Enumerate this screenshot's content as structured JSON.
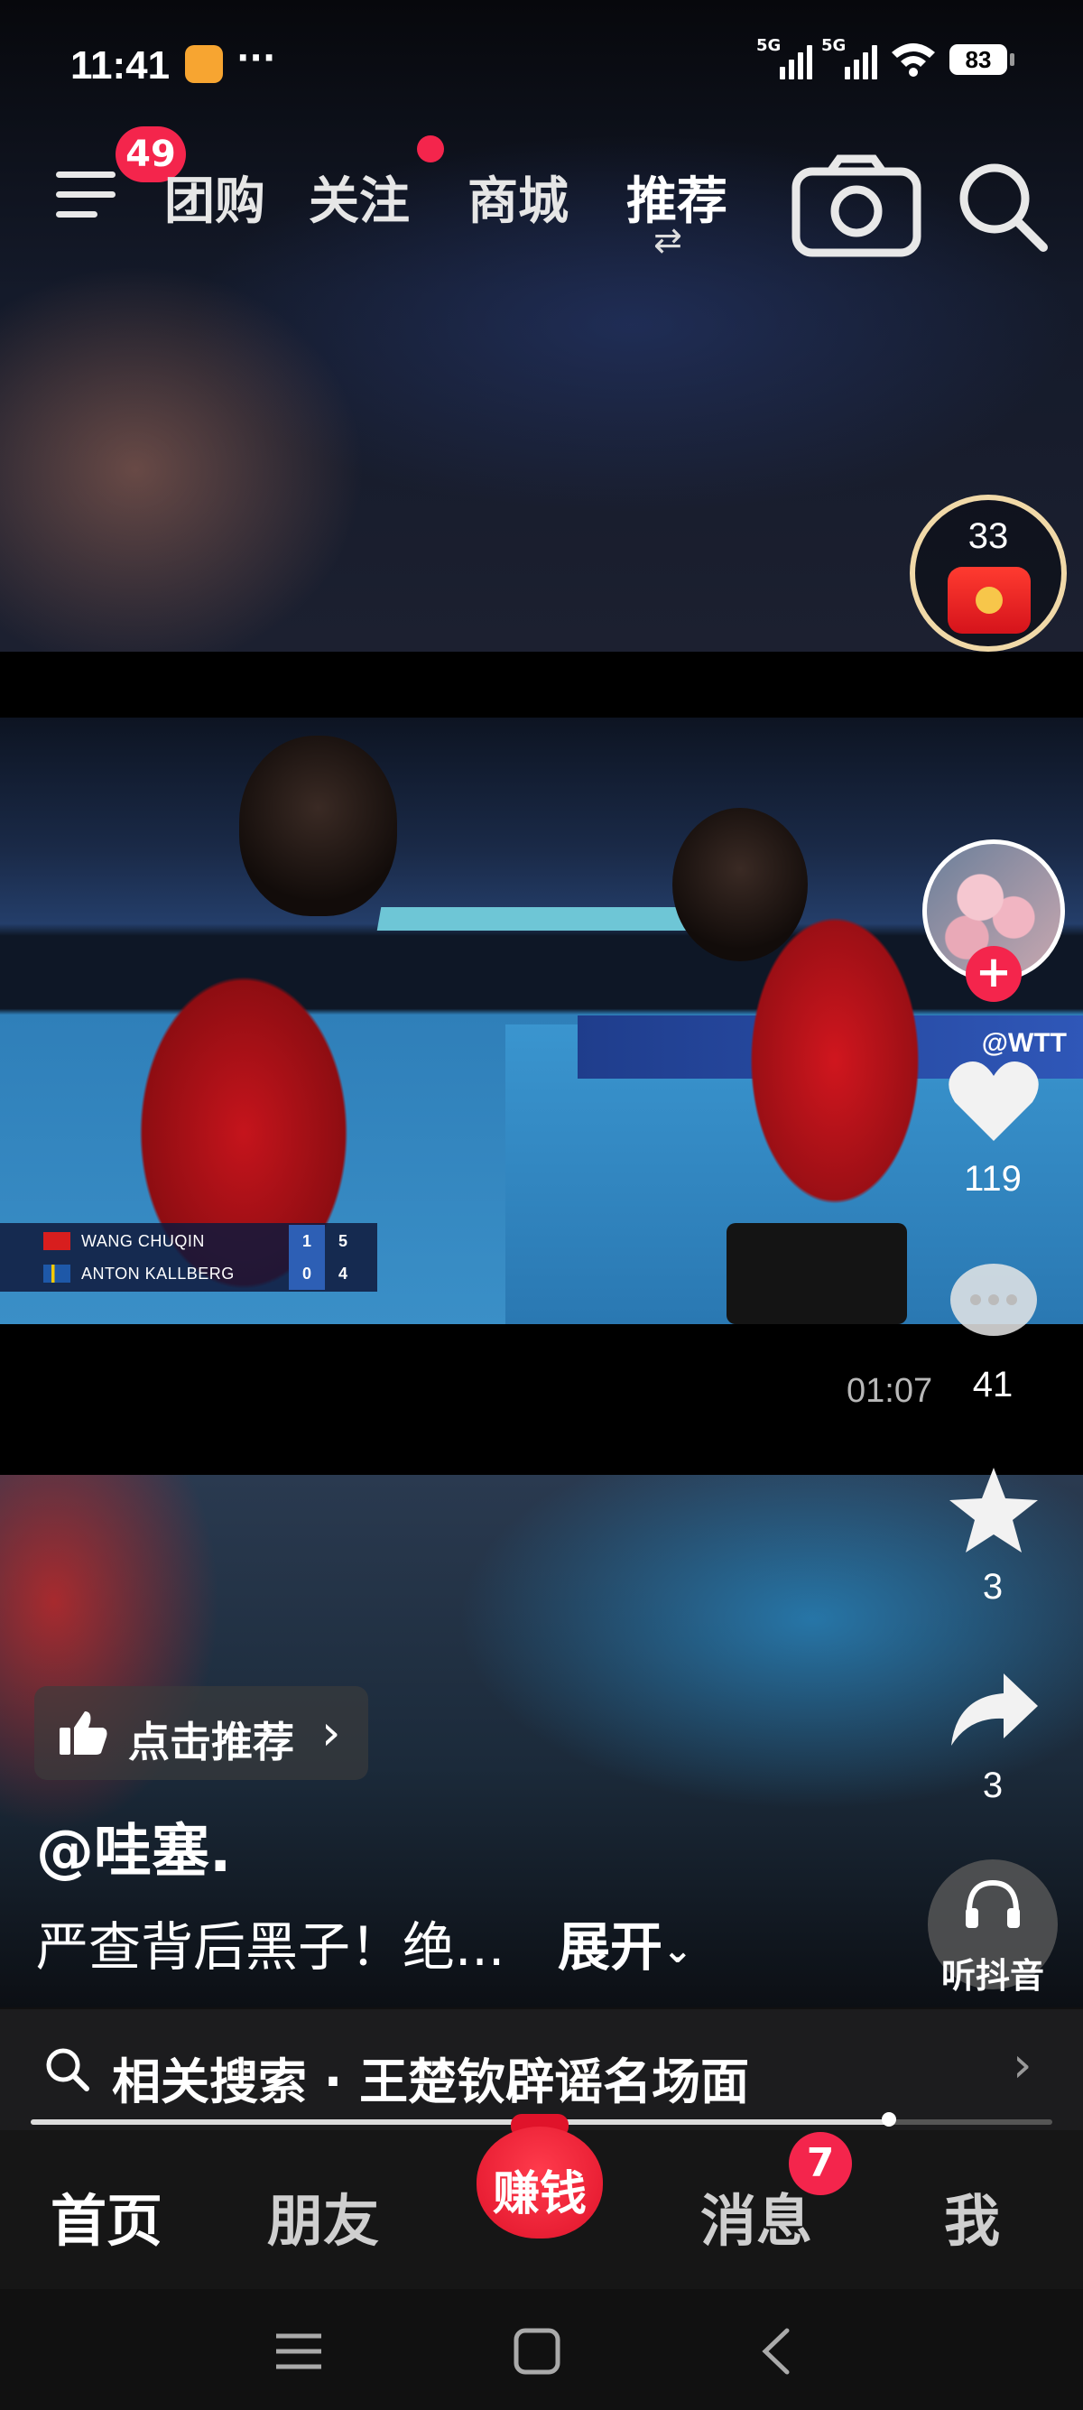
{
  "status_bar": {
    "time": "11:41",
    "more": "···",
    "signal1_label": "5G",
    "signal2_label": "5G",
    "battery": "83"
  },
  "top_nav": {
    "menu_badge": "49",
    "tabs": [
      "团购",
      "关注",
      "商城",
      "推荐"
    ],
    "active_tab": "推荐"
  },
  "red_packet": {
    "count": "33"
  },
  "video": {
    "scoreboard": [
      {
        "name": "WANG CHUQIN",
        "sets": "1",
        "points": "5"
      },
      {
        "name": "ANTON KALLBERG",
        "sets": "0",
        "points": "4"
      }
    ],
    "ad_text": "@WTT",
    "duration": "01:07"
  },
  "right_rail": {
    "likes": "119",
    "comments": "41",
    "favorites": "3",
    "shares": "3"
  },
  "caption": {
    "recommend_label": "点击推荐",
    "author": "@哇塞.",
    "text": "严查背后黑子！绝...",
    "expand": "展开"
  },
  "listen": {
    "label": "听抖音"
  },
  "related_search": {
    "text": "相关搜索 · 王楚钦辟谣名场面"
  },
  "playback": {
    "progress": 0.84
  },
  "bottom_tabs": {
    "home": "首页",
    "friends": "朋友",
    "earn": "赚钱",
    "messages": "消息",
    "messages_badge": "7",
    "me": "我"
  },
  "colors": {
    "accent": "#f4254c",
    "earn": "#e0132a",
    "tabbar": "#161616"
  },
  "icons": [
    "menu-icon",
    "camera-icon",
    "search-icon",
    "heart-icon",
    "comment-icon",
    "star-icon",
    "share-icon",
    "headphones-icon",
    "thumbs-up-icon",
    "chevron-right-icon",
    "chevron-down-icon"
  ]
}
